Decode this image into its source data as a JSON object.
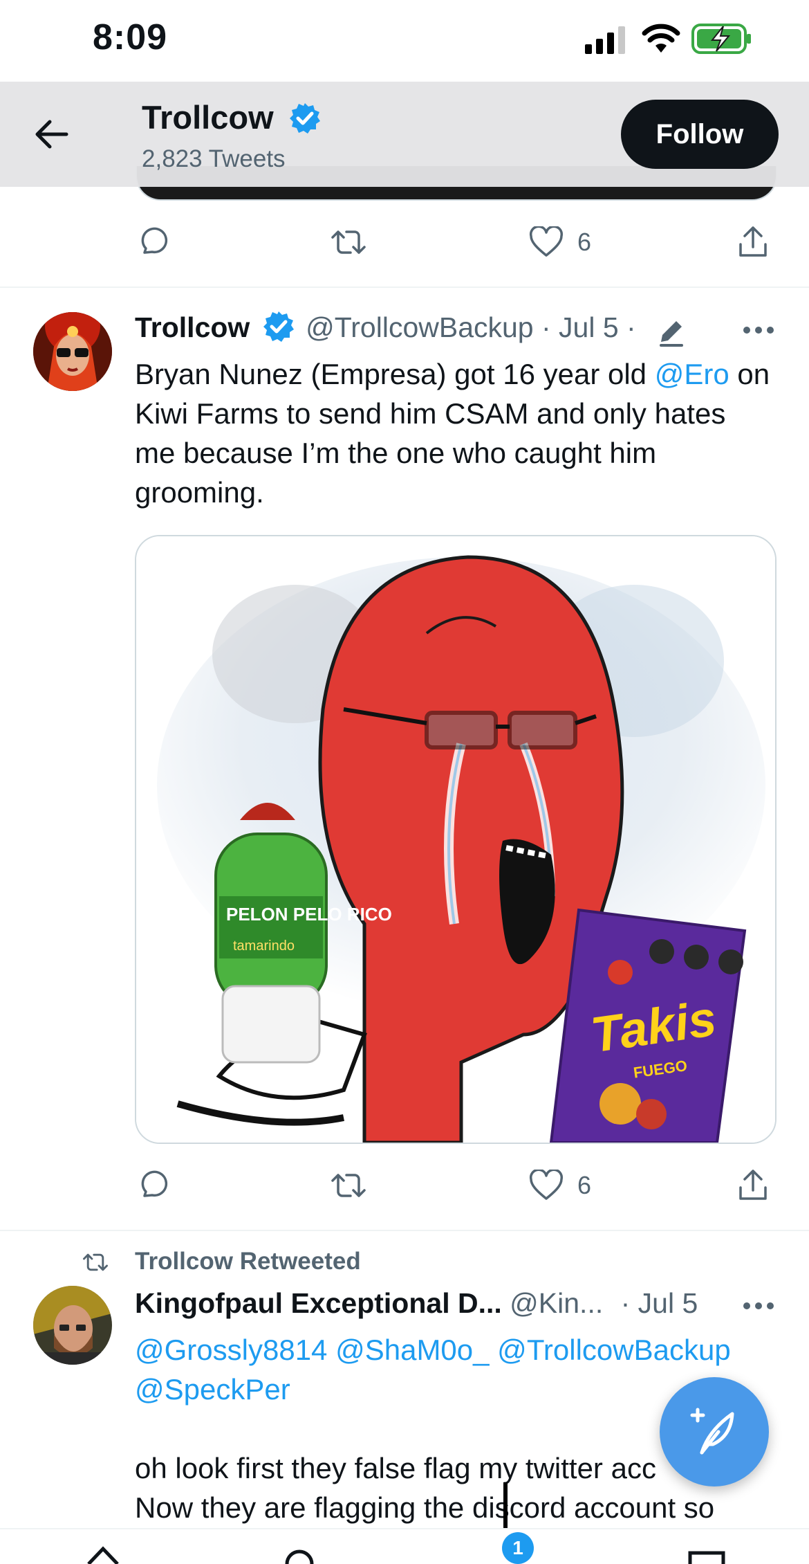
{
  "status_bar": {
    "time": "8:09"
  },
  "header": {
    "name": "Trollcow",
    "tweet_count": "2,823 Tweets",
    "follow_label": "Follow"
  },
  "prev_tweet_actions": {
    "likes": "6"
  },
  "tweet1": {
    "name": "Trollcow",
    "handle": "@TrollcowBackup",
    "date": "· Jul 5 ·",
    "text_line1_a": "Bryan Nunez (Empresa) got 16 year old ",
    "text_line1_mention": "@Ero",
    "text_line1_b": " on",
    "text_line2": "Kiwi Farms to send him CSAM and only hates",
    "text_line3": "me because I’m the one who caught him",
    "text_line4": "grooming.",
    "likes": "6",
    "image_text": {
      "bottle_label": "PELON PELO RICO",
      "bottle_sub": "tamarindo",
      "bag_brand": "Takis",
      "bag_flavor": "FUEGO"
    }
  },
  "tweet2": {
    "retweeted_by": "Trollcow Retweeted",
    "name": "Kingofpaul Exceptional D...",
    "handle": "@Kin...",
    "date": "· Jul 5",
    "mentions_line1": "@Grossly8814 @ShaM0o_ @TrollcowBackup",
    "mentions_line2": "@SpeckPer",
    "text_line1": "oh look first they false flag my twitter acc",
    "text_line2": "Now they are flagging the discord account so"
  },
  "tab_badge": "1",
  "colors": {
    "accent": "#1d9bf0",
    "fab": "#4a99e9",
    "secondary_text": "#536471"
  }
}
